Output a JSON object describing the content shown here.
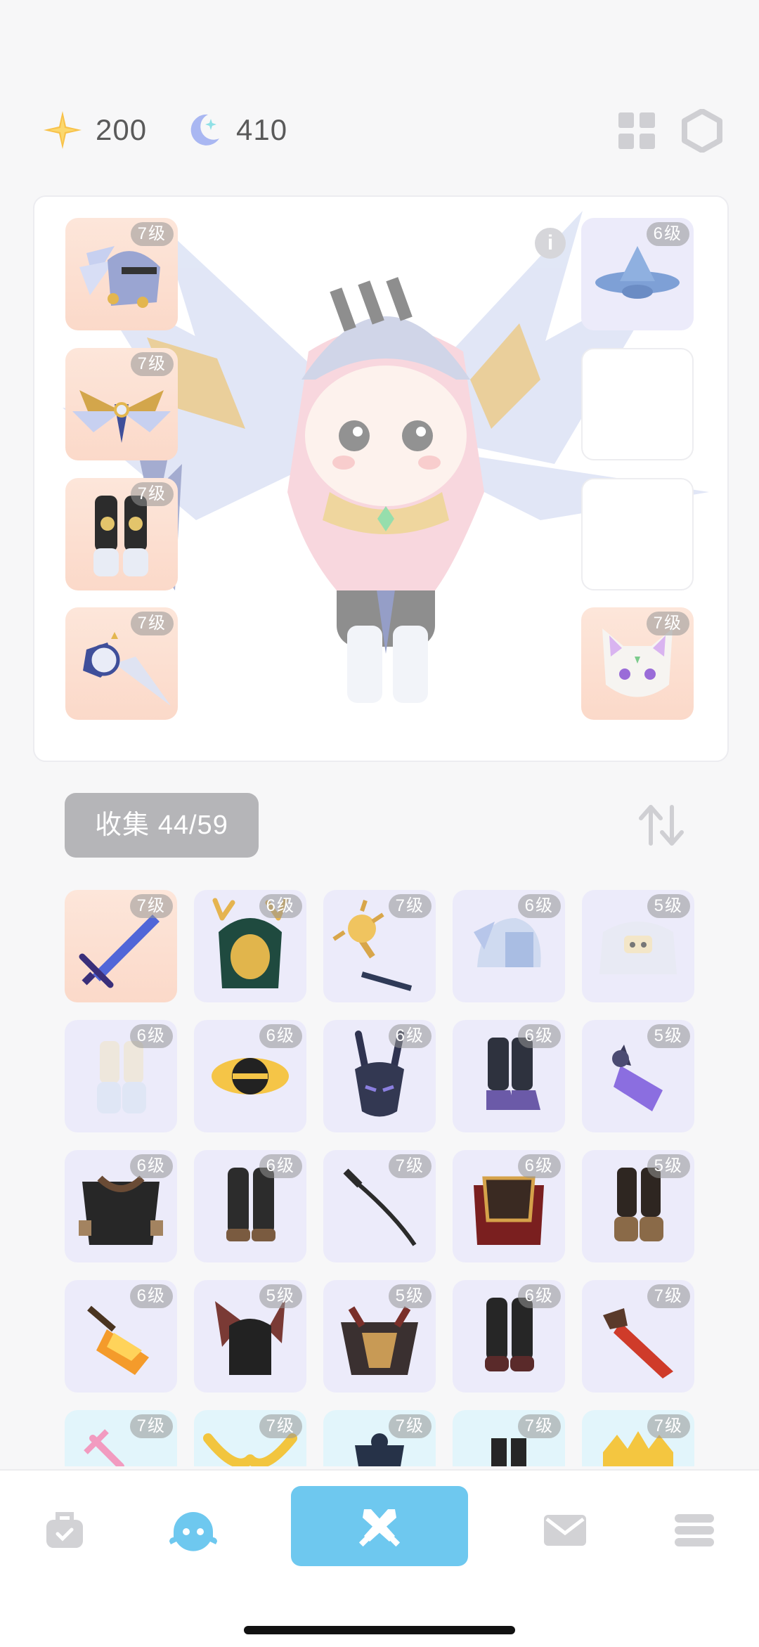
{
  "currency": {
    "stars": "200",
    "moons": "410"
  },
  "equipped": {
    "left": [
      {
        "level": "7级",
        "item": "winged-knight-helmet"
      },
      {
        "level": "7级",
        "item": "golden-wing-armor"
      },
      {
        "level": "7级",
        "item": "knight-pants"
      },
      {
        "level": "7级",
        "item": "star-sword"
      }
    ],
    "right": [
      {
        "level": "6级",
        "item": "blue-hat"
      },
      {
        "level": "",
        "item": "empty"
      },
      {
        "level": "",
        "item": "empty"
      },
      {
        "level": "7级",
        "item": "cat-mask"
      }
    ]
  },
  "collection": {
    "label": "收集 44/59"
  },
  "grid": [
    {
      "level": "7级",
      "item": "blue-sword",
      "tint": "lv7"
    },
    {
      "level": "6级",
      "item": "antler-hood",
      "tint": "lv6"
    },
    {
      "level": "7级",
      "item": "golden-staff",
      "tint": "lv6"
    },
    {
      "level": "6级",
      "item": "blue-helmet",
      "tint": "lv6"
    },
    {
      "level": "5级",
      "item": "white-armor",
      "tint": "lv5"
    },
    {
      "level": "6级",
      "item": "white-boots",
      "tint": "lv6"
    },
    {
      "level": "6级",
      "item": "black-hole-halo",
      "tint": "lv6"
    },
    {
      "level": "6级",
      "item": "horned-dark-mask",
      "tint": "lv6"
    },
    {
      "level": "6级",
      "item": "dark-boots",
      "tint": "lv6"
    },
    {
      "level": "5级",
      "item": "purple-gauntlet",
      "tint": "lv5"
    },
    {
      "level": "6级",
      "item": "black-cape",
      "tint": "lv6"
    },
    {
      "level": "6级",
      "item": "black-pants",
      "tint": "lv6"
    },
    {
      "level": "7级",
      "item": "black-katana",
      "tint": "lv6"
    },
    {
      "level": "6级",
      "item": "red-cape",
      "tint": "lv6"
    },
    {
      "level": "5级",
      "item": "brown-boots",
      "tint": "lv5"
    },
    {
      "level": "6级",
      "item": "flame-blade",
      "tint": "lv6"
    },
    {
      "level": "5级",
      "item": "bat-hood",
      "tint": "lv5"
    },
    {
      "level": "5级",
      "item": "demon-armor",
      "tint": "lv5"
    },
    {
      "level": "6级",
      "item": "dark-pants",
      "tint": "lv6"
    },
    {
      "level": "7级",
      "item": "red-greatsword",
      "tint": "lv6"
    },
    {
      "level": "7级",
      "item": "pink-sword",
      "tint": "cyan"
    },
    {
      "level": "7级",
      "item": "golden-horns",
      "tint": "cyan"
    },
    {
      "level": "7级",
      "item": "dark-armor",
      "tint": "cyan"
    },
    {
      "level": "7级",
      "item": "dark-leggings",
      "tint": "cyan"
    },
    {
      "level": "7级",
      "item": "golden-crown",
      "tint": "cyan"
    }
  ],
  "nav": {
    "items": [
      "bag-icon",
      "character-icon",
      "battle-icon",
      "mail-icon",
      "menu-icon"
    ],
    "active": "battle-icon",
    "accent": "#6ec8ef"
  }
}
